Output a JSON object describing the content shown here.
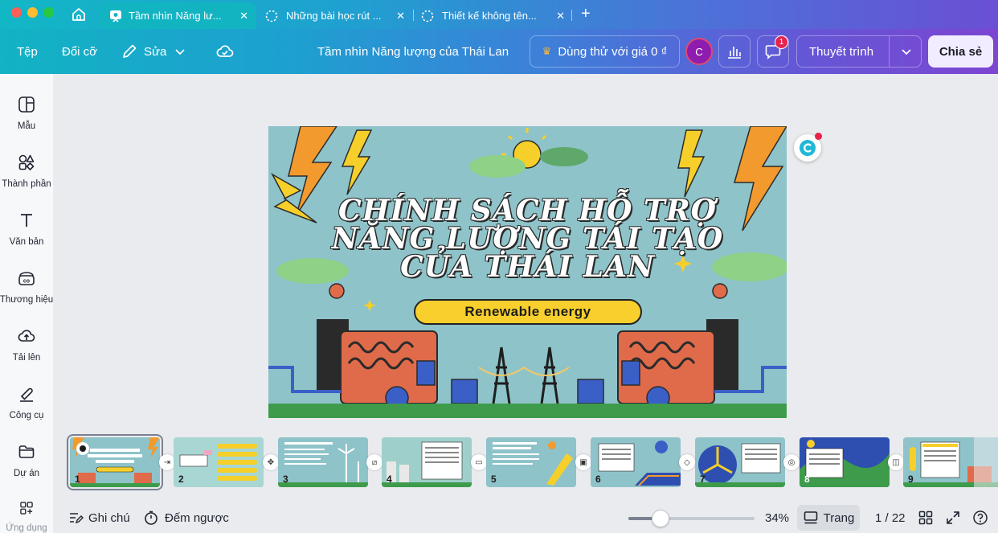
{
  "browser": {
    "tabs": [
      {
        "label": "Tầm nhìn Năng lư...",
        "active": true
      },
      {
        "label": "Những bài học rút ...",
        "active": false
      },
      {
        "label": "Thiết kế không tên...",
        "active": false
      }
    ],
    "new_tab": "+"
  },
  "header": {
    "file": "Tệp",
    "resize": "Đổi cỡ",
    "edit": "Sửa",
    "doc_title": "Tầm nhìn Năng lượng của Thái Lan",
    "trial": "Dùng thử với giá 0 ₫",
    "avatar_initial": "C",
    "comment_badge": "1",
    "present": "Thuyết trình",
    "share": "Chia sẻ"
  },
  "sidebar": {
    "items": [
      {
        "label": "Mẫu",
        "icon": "template-icon"
      },
      {
        "label": "Thành phần",
        "icon": "elements-icon"
      },
      {
        "label": "Văn bản",
        "icon": "text-icon"
      },
      {
        "label": "Thương hiệu",
        "icon": "brand-icon"
      },
      {
        "label": "Tải lên",
        "icon": "upload-icon"
      },
      {
        "label": "Công cụ",
        "icon": "tools-icon"
      },
      {
        "label": "Dự án",
        "icon": "folder-icon"
      },
      {
        "label": "Ứng dụng",
        "icon": "apps-icon"
      }
    ]
  },
  "slide": {
    "title_line1": "CHÍNH SÁCH HỖ TRỢ",
    "title_line2": "NĂNG LƯỢNG TÁI TẠO",
    "title_line3": "CỦA THÁI LAN",
    "tagline": "Renewable energy"
  },
  "filmstrip": {
    "pages": [
      "1",
      "2",
      "3",
      "4",
      "5",
      "6",
      "7",
      "8",
      "9"
    ]
  },
  "bottom": {
    "notes": "Ghi chú",
    "timer": "Đếm ngược",
    "zoom_level": "34%",
    "zoom_fraction": 0.34,
    "page_view": "Trang",
    "page_counter": "1 / 22"
  },
  "colors": {
    "header_gradient_start": "#12b3c4",
    "header_gradient_end": "#7d45d2",
    "slide_background": "#8ec3c9",
    "pill_yellow": "#f8cf2c",
    "avatar_purple": "#8e1cae"
  }
}
